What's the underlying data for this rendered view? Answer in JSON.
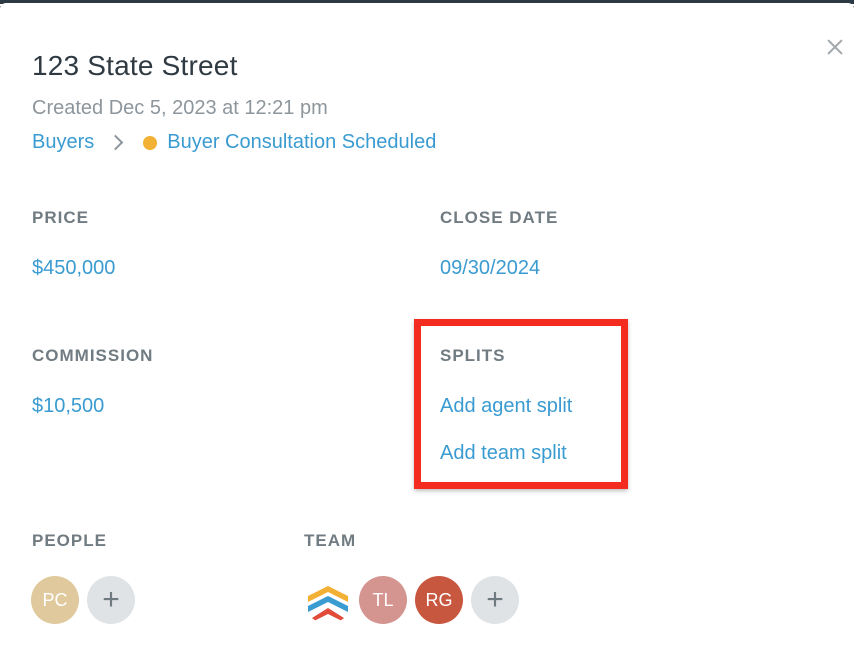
{
  "modal": {
    "title": "123 State Street",
    "created": "Created Dec 5, 2023 at 12:21 pm",
    "breadcrumb": {
      "stage": "Buyers",
      "status": "Buyer Consultation Scheduled",
      "status_color": "#f2b134"
    },
    "fields": {
      "price": {
        "label": "PRICE",
        "value": "$450,000"
      },
      "close_date": {
        "label": "CLOSE DATE",
        "value": "09/30/2024"
      },
      "commission": {
        "label": "COMMISSION",
        "value": "$10,500"
      },
      "splits": {
        "label": "SPLITS",
        "add_agent": "Add agent split",
        "add_team": "Add team split"
      }
    },
    "people": {
      "label": "PEOPLE",
      "avatars": [
        {
          "initials": "PC",
          "color": "#e0c99c"
        }
      ],
      "add_icon": "+"
    },
    "team": {
      "label": "TEAM",
      "avatars": [
        {
          "initials": "TL",
          "color": "#d4948f"
        },
        {
          "initials": "RG",
          "color": "#c8573f"
        }
      ],
      "add_icon": "+"
    },
    "icons": {
      "close": "close-icon",
      "chevron": "chevron-right-icon",
      "team_logo": "team-logo-icon"
    },
    "highlight_color": "#f42b1f",
    "accent": "#3a9bd1"
  }
}
